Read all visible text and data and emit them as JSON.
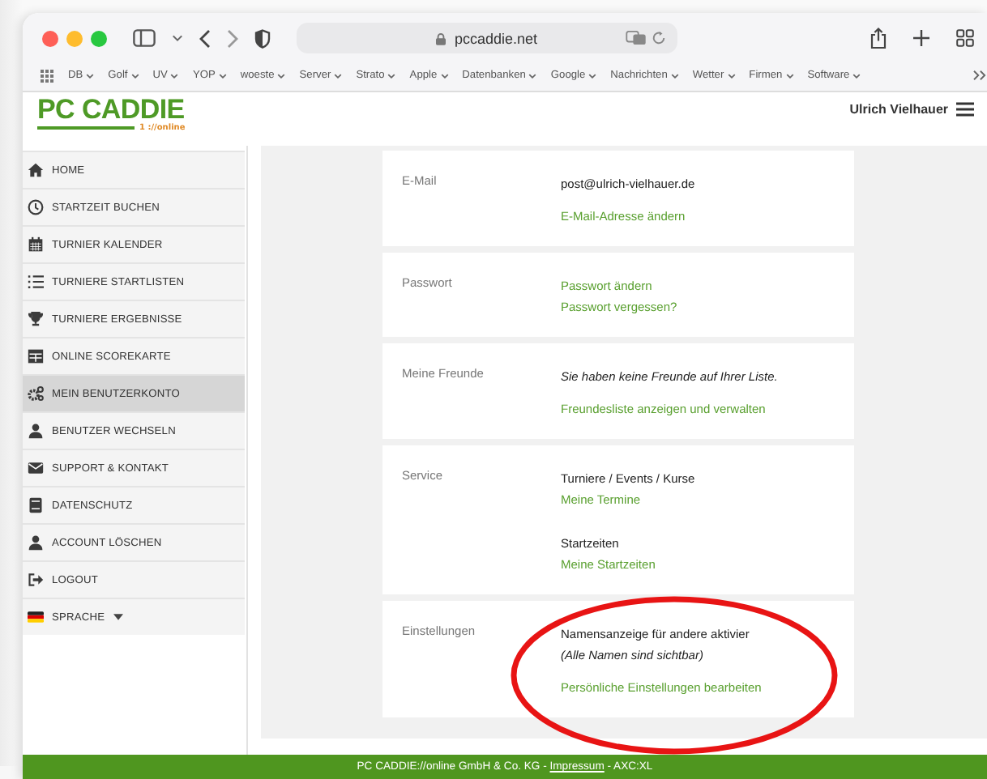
{
  "browser": {
    "address": "pccaddie.net",
    "bookmarks": [
      "DB",
      "Golf",
      "UV",
      "YOP",
      "woeste",
      "Server",
      "Strato",
      "Apple",
      "Datenbanken",
      "Google",
      "Nachrichten",
      "Wetter",
      "Firmen",
      "Software"
    ]
  },
  "header": {
    "logo": "PC CADDIE",
    "logo_sub": "1 ://online",
    "user": "Ulrich Vielhauer"
  },
  "sidebar": {
    "items": [
      {
        "label": "HOME",
        "selected": false
      },
      {
        "label": "STARTZEIT BUCHEN",
        "selected": false
      },
      {
        "label": "TURNIER KALENDER",
        "selected": false
      },
      {
        "label": "TURNIERE STARTLISTEN",
        "selected": false
      },
      {
        "label": "TURNIERE ERGEBNISSE",
        "selected": false
      },
      {
        "label": "ONLINE SCOREKARTE",
        "selected": false
      },
      {
        "label": "MEIN BENUTZERKONTO",
        "selected": true
      },
      {
        "label": "BENUTZER WECHSELN",
        "selected": false
      },
      {
        "label": "SUPPORT & KONTAKT",
        "selected": false
      },
      {
        "label": "DATENSCHUTZ",
        "selected": false
      },
      {
        "label": "ACCOUNT LÖSCHEN",
        "selected": false
      },
      {
        "label": "LOGOUT",
        "selected": false
      },
      {
        "label": "SPRACHE",
        "selected": false,
        "dropdown": true
      }
    ]
  },
  "cards": [
    {
      "label": "E-Mail",
      "lines": [
        {
          "kind": "text",
          "text": "post@ulrich-vielhauer.de"
        },
        {
          "kind": "gap"
        },
        {
          "kind": "link",
          "text": "E-Mail-Adresse ändern"
        }
      ]
    },
    {
      "label": "Passwort",
      "lines": [
        {
          "kind": "link",
          "text": "Passwort ändern"
        },
        {
          "kind": "link",
          "text": "Passwort vergessen?"
        }
      ]
    },
    {
      "label": "Meine Freunde",
      "lines": [
        {
          "kind": "note",
          "text": "Sie haben keine Freunde auf Ihrer Liste."
        },
        {
          "kind": "gap"
        },
        {
          "kind": "link",
          "text": "Freundesliste anzeigen und verwalten"
        }
      ]
    },
    {
      "label": "Service",
      "lines": [
        {
          "kind": "text",
          "text": "Turniere / Events / Kurse"
        },
        {
          "kind": "link",
          "text": "Meine Termine"
        },
        {
          "kind": "gap"
        },
        {
          "kind": "gap"
        },
        {
          "kind": "text",
          "text": "Startzeiten"
        },
        {
          "kind": "link",
          "text": "Meine Startzeiten"
        }
      ]
    },
    {
      "label": "Einstellungen",
      "lines": [
        {
          "kind": "text",
          "text": "Namensanzeige für andere aktivier"
        },
        {
          "kind": "note",
          "text": "(Alle Namen sind sichtbar)"
        },
        {
          "kind": "gap"
        },
        {
          "kind": "link",
          "text": "Persönliche Einstellungen bearbeiten"
        }
      ]
    }
  ],
  "footer": {
    "text_before": "PC CADDIE://online GmbH & Co. KG - ",
    "link": "Impressum",
    "text_after": " - AXC:XL"
  }
}
